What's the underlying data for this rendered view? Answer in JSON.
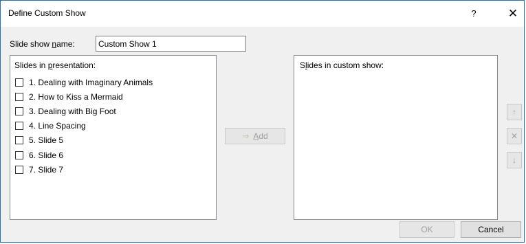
{
  "window": {
    "title": "Define Custom Show",
    "help_label": "?",
    "close_label": "✕"
  },
  "show_name": {
    "label_before": "Slide show ",
    "label_mnemonic": "n",
    "label_after": "ame:",
    "value": "Custom Show 1"
  },
  "presentation_list": {
    "heading_before": "Slides in ",
    "heading_mnemonic": "p",
    "heading_after": "resentation:",
    "items": [
      {
        "label": "1. Dealing with Imaginary Animals",
        "checked": false
      },
      {
        "label": "2. How to Kiss a Mermaid",
        "checked": false
      },
      {
        "label": "3. Dealing with Big Foot",
        "checked": false
      },
      {
        "label": "4. Line Spacing",
        "checked": false
      },
      {
        "label": "5. Slide 5",
        "checked": false
      },
      {
        "label": "6. Slide 6",
        "checked": false
      },
      {
        "label": "7. Slide 7",
        "checked": false
      }
    ]
  },
  "add_button": {
    "arrow_icon": "add-arrow-icon",
    "label_mnemonic": "A",
    "label_after": "dd",
    "enabled": false
  },
  "custom_show_list": {
    "heading_before": "S",
    "heading_mnemonic": "l",
    "heading_after": "ides in custom show:",
    "items": []
  },
  "side_buttons": {
    "up_icon": "↑",
    "remove_icon": "✕",
    "down_icon": "↓"
  },
  "footer": {
    "ok_label": "OK",
    "cancel_label": "Cancel"
  },
  "colors": {
    "border_accent": "#1f6fb5",
    "dialog_bg": "#f0f0f0",
    "disabled_text": "#a0a0a0"
  }
}
